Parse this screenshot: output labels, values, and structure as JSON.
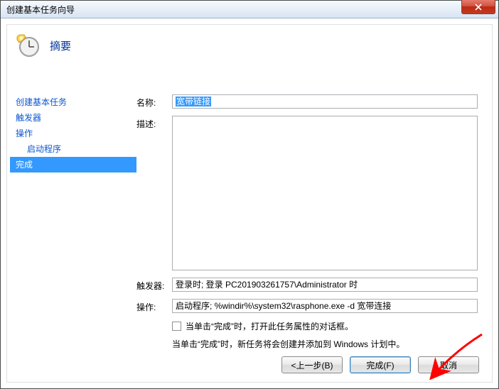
{
  "window": {
    "title": "创建基本任务向导"
  },
  "header": {
    "summary_title": "摘要"
  },
  "sidebar": {
    "items": [
      {
        "label": "创建基本任务",
        "indent": false,
        "active": false
      },
      {
        "label": "触发器",
        "indent": false,
        "active": false
      },
      {
        "label": "操作",
        "indent": false,
        "active": false
      },
      {
        "label": "启动程序",
        "indent": true,
        "active": false
      },
      {
        "label": "完成",
        "indent": false,
        "active": true
      }
    ]
  },
  "form": {
    "name_label": "名称:",
    "name_value": "宽带链接",
    "desc_label": "描述:",
    "desc_value": "",
    "trigger_label": "触发器:",
    "trigger_value": "登录时; 登录 PC201903261757\\Administrator 时",
    "action_label": "操作:",
    "action_value": "启动程序; %windir%\\system32\\rasphone.exe -d 宽带连接",
    "checkbox_label": "当单击“完成”时，打开此任务属性的对话框。",
    "info_text": "当单击“完成”时，新任务将会创建并添加到 Windows 计划中。"
  },
  "buttons": {
    "back": "<上一步(B)",
    "finish": "完成(F)",
    "cancel": "取消"
  }
}
